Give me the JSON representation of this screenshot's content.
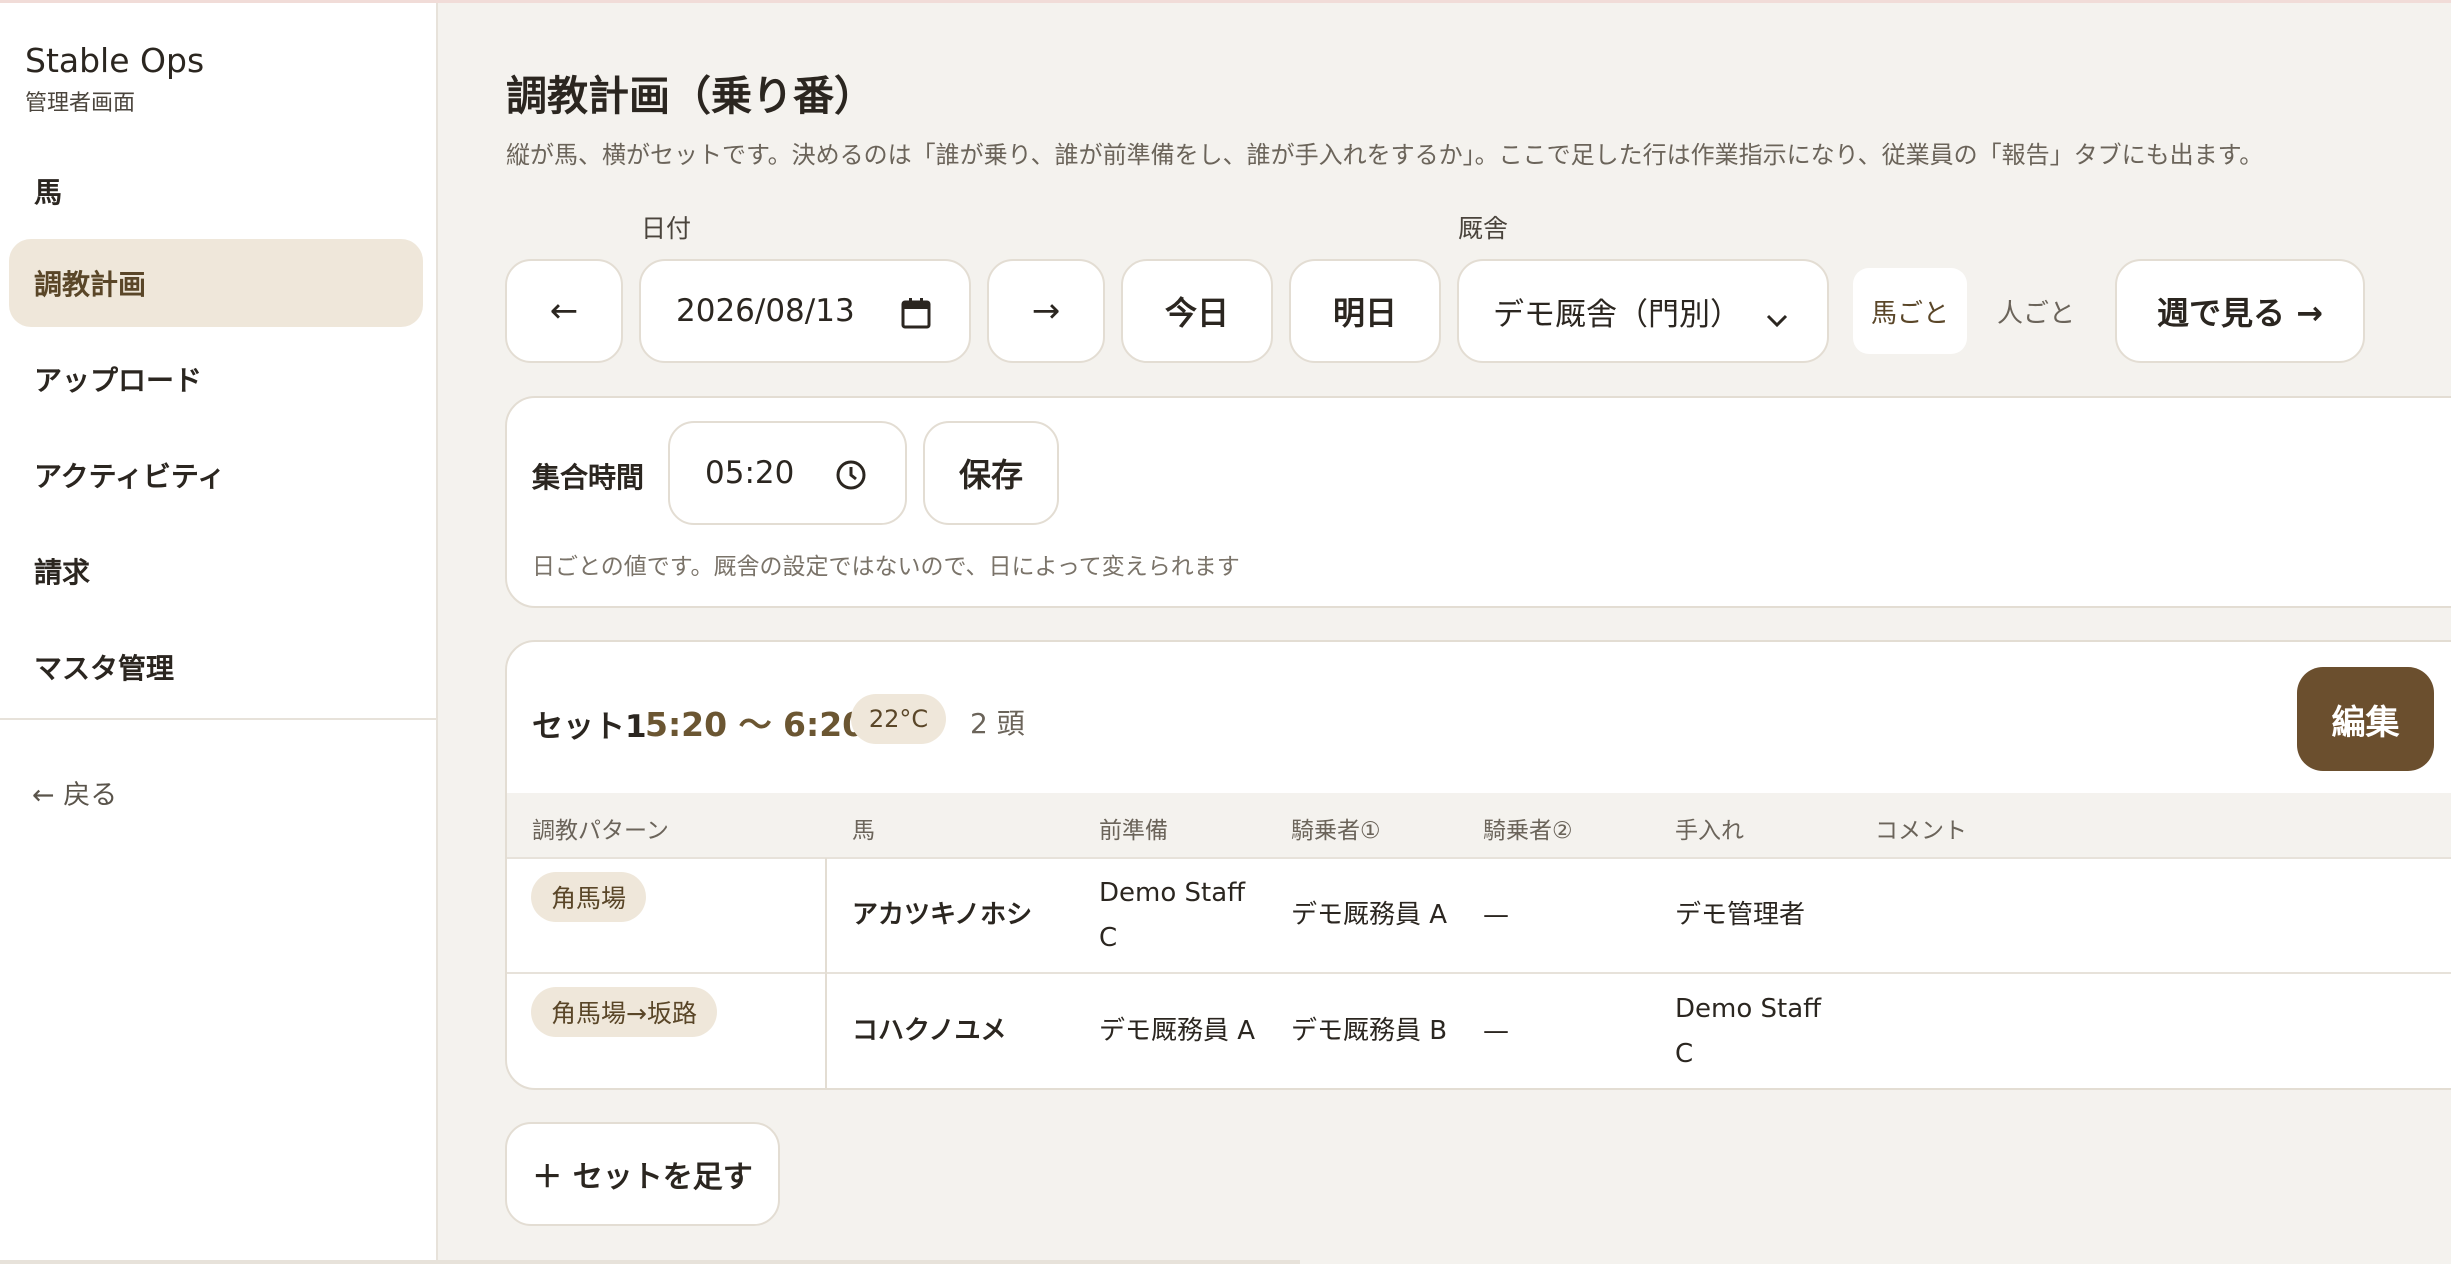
{
  "sidebar": {
    "brand": "Stable Ops",
    "subtitle": "管理者画面",
    "items": [
      {
        "label": "馬"
      },
      {
        "label": "調教計画"
      },
      {
        "label": "アップロード"
      },
      {
        "label": "アクティビティ"
      },
      {
        "label": "請求"
      },
      {
        "label": "マスタ管理"
      }
    ],
    "active_item": "調教計画",
    "back": "← 戻る"
  },
  "header": {
    "title": "調教計画（乗り番）",
    "description": "縦が馬、横がセットです。決めるのは「誰が乗り、誰が前準備をし、誰が手入れをするか」。ここで足した行は作業指示になり、従業員の「報告」タブにも出ます。"
  },
  "controls": {
    "date_label": "日付",
    "prev": "←",
    "date_value": "2026/08/13",
    "next": "→",
    "today": "今日",
    "tomorrow": "明日",
    "stable_label": "厩舎",
    "stable_value": "デモ厩舎（門別）",
    "view_by_horse": "馬ごと",
    "view_by_person": "人ごと",
    "week_view": "週で見る →"
  },
  "assembly": {
    "label": "集合時間",
    "time": "05:20",
    "save": "保存",
    "hint": "日ごとの値です。厩舎の設定ではないので、日によって変えられます"
  },
  "set": {
    "name": "セット1",
    "time_range": "5:20 〜 6:20",
    "temperature": "22°C",
    "count": "2 頭",
    "edit": "編集",
    "columns": [
      "調教パターン",
      "馬",
      "前準備",
      "騎乗者①",
      "騎乗者②",
      "手入れ",
      "コメント"
    ],
    "rows": [
      {
        "pattern": "角馬場",
        "horse": "アカツキノホシ",
        "prep": "Demo Staff C",
        "rider1": "デモ厩務員 A",
        "rider2": "—",
        "care": "デモ管理者",
        "comment": ""
      },
      {
        "pattern": "角馬場→坂路",
        "horse": "コハクノユメ",
        "prep": "デモ厩務員 A",
        "rider1": "デモ厩務員 B",
        "rider2": "—",
        "care": "Demo Staff C",
        "comment": ""
      }
    ]
  },
  "add_set": "＋ セットを足す",
  "colors": {
    "background": "#f4f2ee",
    "active_nav": "#efe7da",
    "accent_brown": "#6b4f2e",
    "time_text": "#6b5632"
  },
  "icons": {
    "calendar": "calendar-icon",
    "clock": "clock-icon",
    "chevron": "chevron-down-icon"
  }
}
